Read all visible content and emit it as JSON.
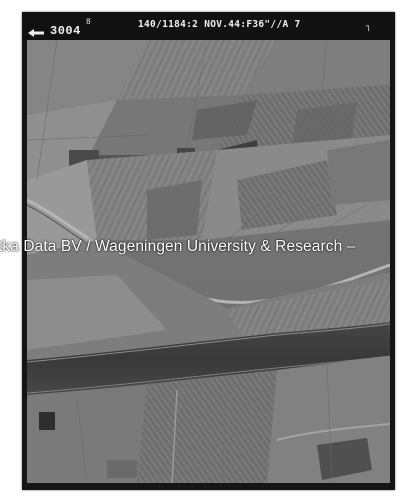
{
  "photo": {
    "frame_number": "3004",
    "frame_number_suffix": "8",
    "flight_info": "140/1184:2 NOV.44:F36\"//A 7",
    "corner_mark": "┐"
  },
  "watermark": {
    "text": "tka Data BV / Wageningen University & Research –"
  },
  "colors": {
    "frame": "#151515",
    "river": "#3d3d3d",
    "field_light": "#8a8a8a",
    "field_dark": "#5a5a5a"
  }
}
